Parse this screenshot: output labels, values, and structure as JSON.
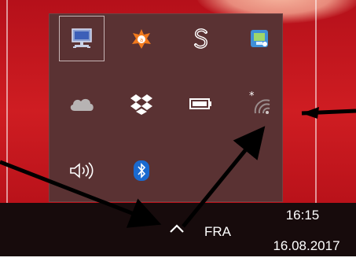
{
  "taskbar": {
    "language": "FRA",
    "time": "16:15",
    "date": "16.08.2017",
    "show_hidden_icons": "chevron-up-icon"
  },
  "tray": {
    "icons": [
      {
        "name": "display-icon",
        "selected": true
      },
      {
        "name": "avast-icon"
      },
      {
        "name": "sync-s-icon"
      },
      {
        "name": "network-app-icon"
      },
      {
        "name": "onedrive-cloud-icon"
      },
      {
        "name": "dropbox-icon"
      },
      {
        "name": "battery-icon"
      },
      {
        "name": "wifi-off-icon"
      },
      {
        "name": "volume-icon"
      },
      {
        "name": "bluetooth-icon"
      }
    ]
  },
  "colors": {
    "desktop": "#c3121a",
    "popup": "#5a3233",
    "taskbar": "#170b0c",
    "annotation": "#000000"
  }
}
